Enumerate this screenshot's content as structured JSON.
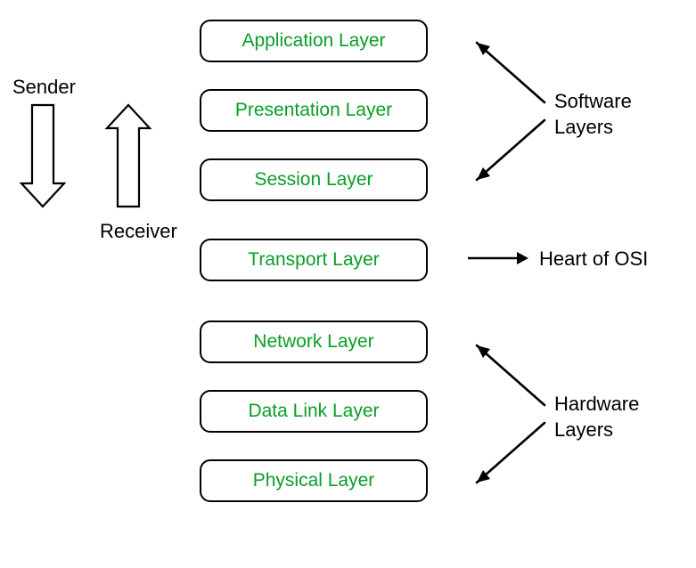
{
  "layers": [
    "Application Layer",
    "Presentation Layer",
    "Session Layer",
    "Transport Layer",
    "Network Layer",
    "Data Link Layer",
    "Physical Layer"
  ],
  "labels": {
    "sender": "Sender",
    "receiver": "Receiver",
    "heart": "Heart of OSI",
    "software_line1": "Software",
    "software_line2": "Layers",
    "hardware_line1": "Hardware",
    "hardware_line2": "Layers"
  }
}
